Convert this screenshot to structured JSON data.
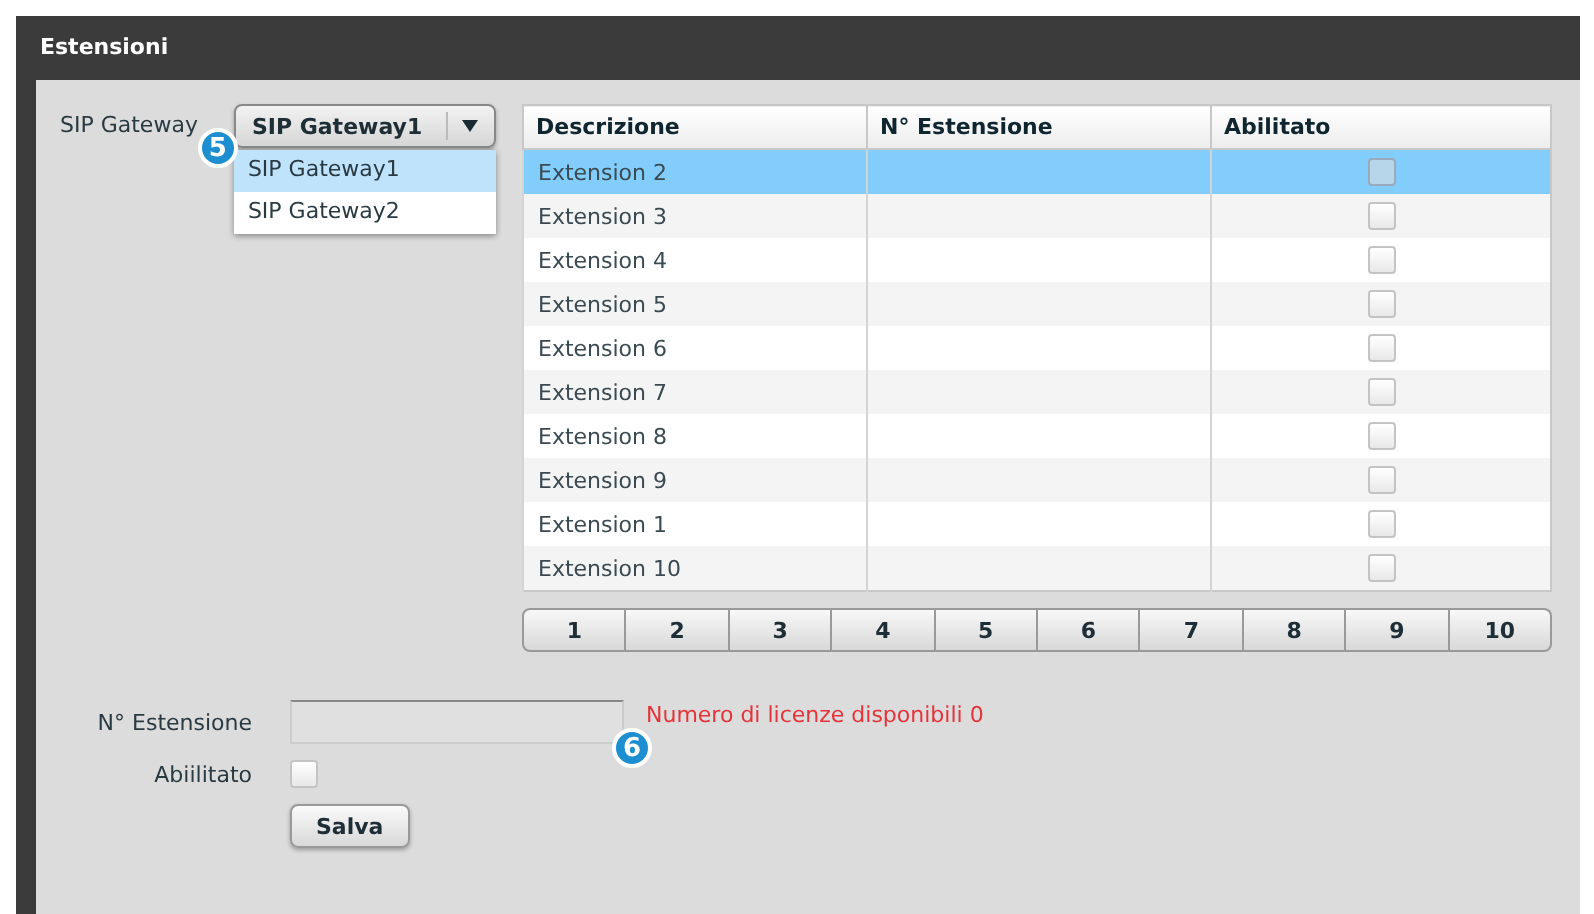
{
  "panel": {
    "title": "Estensioni"
  },
  "gateway": {
    "label": "SIP Gateway",
    "value": "SIP Gateway1",
    "expanded": true,
    "callout": "5",
    "options": [
      {
        "label": "SIP Gateway1",
        "selected": true
      },
      {
        "label": "SIP Gateway2",
        "selected": false
      }
    ]
  },
  "table": {
    "columns": [
      "Descrizione",
      "N° Estensione",
      "Abilitato"
    ],
    "rows": [
      {
        "description": "Extension 2",
        "enabled": false,
        "selected": true
      },
      {
        "description": "Extension 3",
        "enabled": false,
        "selected": false
      },
      {
        "description": "Extension 4",
        "enabled": false,
        "selected": false
      },
      {
        "description": "Extension 5",
        "enabled": false,
        "selected": false
      },
      {
        "description": "Extension 6",
        "enabled": false,
        "selected": false
      },
      {
        "description": "Extension 7",
        "enabled": false,
        "selected": false
      },
      {
        "description": "Extension 8",
        "enabled": false,
        "selected": false
      },
      {
        "description": "Extension 9",
        "enabled": false,
        "selected": false
      },
      {
        "description": "Extension 1",
        "enabled": false,
        "selected": false
      },
      {
        "description": "Extension 10",
        "enabled": false,
        "selected": false
      }
    ]
  },
  "pagination": [
    "1",
    "2",
    "3",
    "4",
    "5",
    "6",
    "7",
    "8",
    "9",
    "10"
  ],
  "form": {
    "number_label": "N° Estensione",
    "license_note": "Numero di licenze disponibili 0",
    "callout": "6",
    "enabled_label": "Abiilitato",
    "enabled": false,
    "save_button": "Salva"
  }
}
